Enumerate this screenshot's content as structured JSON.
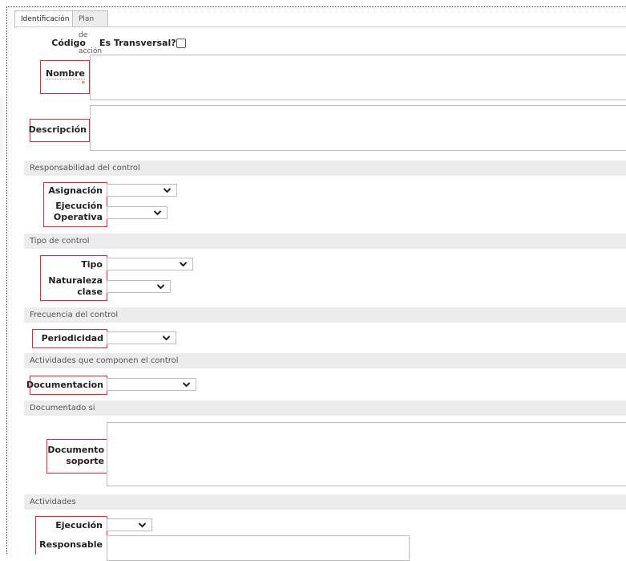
{
  "tabs": [
    {
      "label": "Identificación",
      "active": true
    },
    {
      "label": "Plan de acción",
      "active": false
    }
  ],
  "identificacion": {
    "codigo_label": "Código",
    "transversal_label": "Es Transversal?",
    "transversal_checked": false,
    "nombre_label": "Nombre",
    "required_mark": "*",
    "descripcion_label": "Descripción"
  },
  "sections": {
    "responsabilidad": "Responsabilidad del control",
    "tipo_control": "Tipo de control",
    "frecuencia": "Frecuencia del control",
    "actividades_componen": "Actividades que componen el control",
    "documentado_si": "Documentado si",
    "actividades": "Actividades"
  },
  "fields": {
    "asignacion": {
      "label": "Asignación",
      "value": ""
    },
    "ejecucion_operativa": {
      "label_line1": "Ejecución",
      "label_line2": "Operativa",
      "value": ""
    },
    "tipo": {
      "label": "Tipo",
      "value": ""
    },
    "naturaleza_clase": {
      "label_line1": "Naturaleza",
      "label_line2": "clase",
      "value": ""
    },
    "periodicidad": {
      "label": "Periodicidad",
      "value": ""
    },
    "documentacion": {
      "label": "Documentacion",
      "value": ""
    },
    "documento_soporte": {
      "label_line1": "Documento",
      "label_line2": "soporte",
      "value": ""
    },
    "ejecucion": {
      "label": "Ejecución",
      "value": ""
    },
    "responsable": {
      "label": "Responsable",
      "value": ""
    }
  },
  "colors": {
    "highlight_border": "#e0293a",
    "section_bg": "#ececec",
    "required": "#d0272f"
  }
}
